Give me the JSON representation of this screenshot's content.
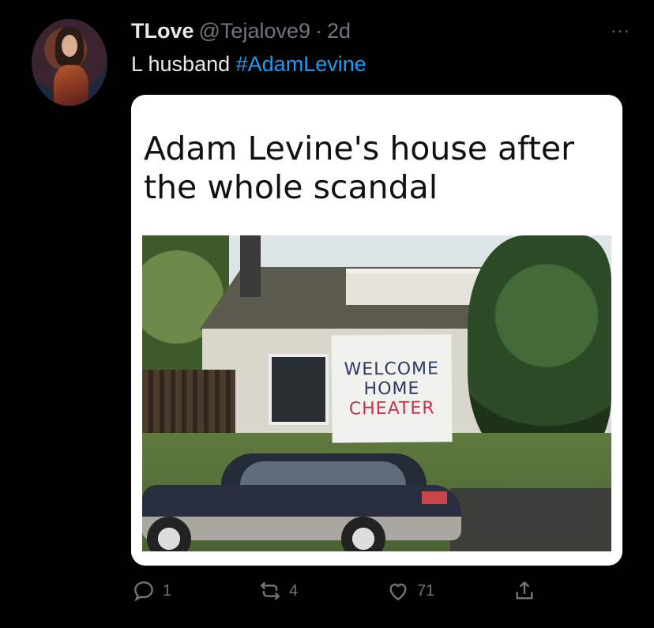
{
  "tweet": {
    "author_name": "TLove",
    "handle": "@Tejalove9",
    "separator": "·",
    "time": "2d",
    "more_label": "···",
    "text_prefix": "L husband",
    "hashtag": "#AdamLevine"
  },
  "media": {
    "caption_line1": "Adam Levine's house after",
    "caption_line2": "the whole scandal",
    "banner_line1": "WELCOME",
    "banner_line2": "HOME",
    "banner_line3": "CHEATER"
  },
  "actions": {
    "reply_count": "1",
    "retweet_count": "4",
    "like_count": "71"
  },
  "colors": {
    "background": "#000000",
    "text": "#e7e9ea",
    "muted": "#71767b",
    "link": "#1d9bf0"
  },
  "icons": {
    "reply": "reply-icon",
    "retweet": "retweet-icon",
    "like": "heart-icon",
    "share": "share-icon",
    "more": "more-icon"
  }
}
